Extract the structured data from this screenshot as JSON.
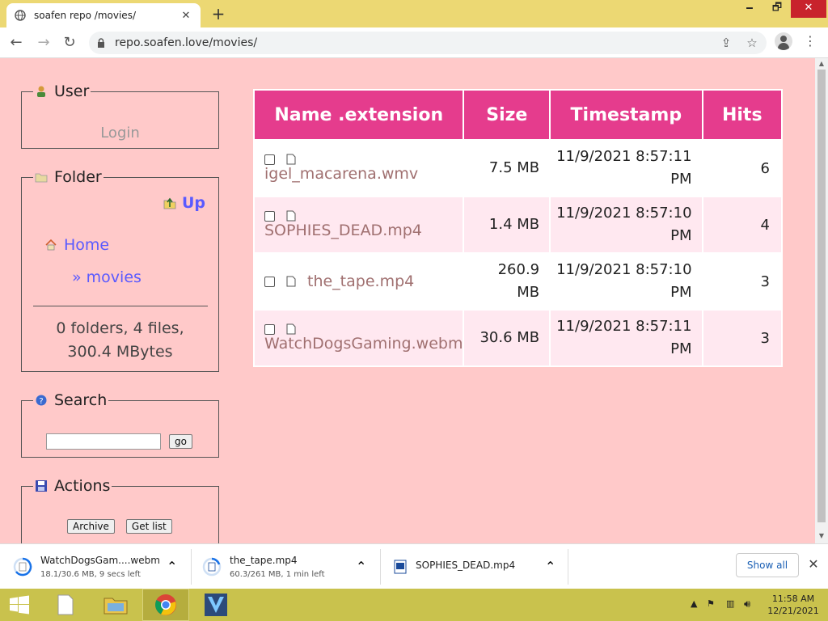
{
  "browser": {
    "tab_title": "soafen repo /movies/",
    "new_tab": "+",
    "url": "repo.soafen.love/movies/",
    "window_controls": {
      "minimize": "🗕",
      "maximize": "🗗",
      "close": "✕"
    }
  },
  "sidebar": {
    "user": {
      "legend": "User",
      "login": "Login"
    },
    "folder": {
      "legend": "Folder",
      "up": "Up",
      "home": "Home",
      "current": "» movies",
      "stats_line1": "0 folders, 4 files,",
      "stats_line2": "300.4 MBytes"
    },
    "search": {
      "legend": "Search",
      "button": "go",
      "value": ""
    },
    "actions": {
      "legend": "Actions",
      "archive": "Archive",
      "get_list": "Get list"
    }
  },
  "table": {
    "headers": [
      "Name .extension",
      "Size",
      "Timestamp",
      "Hits"
    ],
    "rows": [
      {
        "name": "igel_macarena.wmv",
        "size_line1": "7.5 MB",
        "size_line2": "",
        "ts_line1": "11/9/2021 8:57:11",
        "ts_line2": "PM",
        "hits": "6"
      },
      {
        "name": "SOPHIES_DEAD.mp4",
        "size_line1": "1.4 MB",
        "size_line2": "",
        "ts_line1": "11/9/2021 8:57:10",
        "ts_line2": "PM",
        "hits": "4"
      },
      {
        "name": "the_tape.mp4",
        "size_line1": "260.9",
        "size_line2": "MB",
        "ts_line1": "11/9/2021 8:57:10",
        "ts_line2": "PM",
        "hits": "3"
      },
      {
        "name": "WatchDogsGaming.webm",
        "size_line1": "30.6 MB",
        "size_line2": "",
        "ts_line1": "11/9/2021 8:57:11",
        "ts_line2": "PM",
        "hits": "3"
      }
    ]
  },
  "downloads": [
    {
      "name": "WatchDogsGam....webm",
      "status": "18.1/30.6 MB, 9 secs left"
    },
    {
      "name": "the_tape.mp4",
      "status": "60.3/261 MB, 1 min left"
    },
    {
      "name": "SOPHIES_DEAD.mp4",
      "status": ""
    }
  ],
  "shelf": {
    "show_all": "Show all"
  },
  "taskbar": {
    "time": "11:58 AM",
    "date": "12/21/2021"
  },
  "colors": {
    "header": "#e53c8d",
    "link": "#5a5aff",
    "page_bg": "#ffc9c9",
    "tabbar": "#ecd873",
    "taskbar": "#c9c24d"
  }
}
